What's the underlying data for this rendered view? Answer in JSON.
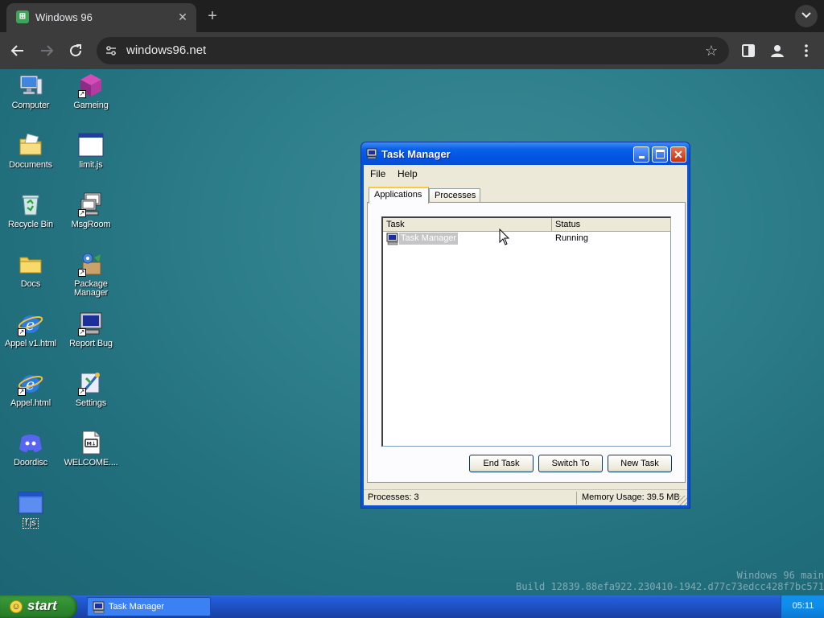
{
  "browser": {
    "tab_title": "Windows 96",
    "url": "windows96.net",
    "icons": [
      "back-arrow-icon",
      "forward-arrow-icon",
      "reload-icon",
      "site-settings-icon",
      "bookmark-star-icon",
      "side-panel-icon",
      "profile-icon",
      "more-menu-icon"
    ]
  },
  "desktop": {
    "icons": [
      {
        "label": "Computer"
      },
      {
        "label": "Gameing"
      },
      {
        "label": "Documents"
      },
      {
        "label": "limit.js"
      },
      {
        "label": "Recycle Bin"
      },
      {
        "label": "MsgRoom"
      },
      {
        "label": "Docs"
      },
      {
        "label": "Package Manager"
      },
      {
        "label": "Appel v1.html"
      },
      {
        "label": "Report Bug"
      },
      {
        "label": "Appel.html"
      },
      {
        "label": "Settings"
      },
      {
        "label": "Doordisc"
      },
      {
        "label": "WELCOME...."
      },
      {
        "label": "f.js"
      }
    ],
    "watermark_line1": "Windows 96 main",
    "watermark_line2": "Build 12839.88efa922.230410-1942.d77c73edcc428f7bc571"
  },
  "task_manager": {
    "title": "Task Manager",
    "menu": [
      "File",
      "Help"
    ],
    "tabs": [
      "Applications",
      "Processes"
    ],
    "active_tab": "Applications",
    "columns": [
      "Task",
      "Status"
    ],
    "rows": [
      {
        "task": "Task Manager",
        "status": "Running"
      }
    ],
    "buttons": {
      "end_task": "End Task",
      "switch_to": "Switch To",
      "new_task": "New Task"
    },
    "status": {
      "processes": "Processes: 3",
      "memory": "Memory Usage: 39.5 MB"
    }
  },
  "taskbar": {
    "start_label": "start",
    "task_button": "Task Manager",
    "clock": "05:11"
  },
  "colors": {
    "desktop_teal": "#2e7f8c",
    "xp_title_blue": "#0054e3",
    "start_green": "#2f8b2f",
    "taskbar_blue": "#245edb"
  }
}
